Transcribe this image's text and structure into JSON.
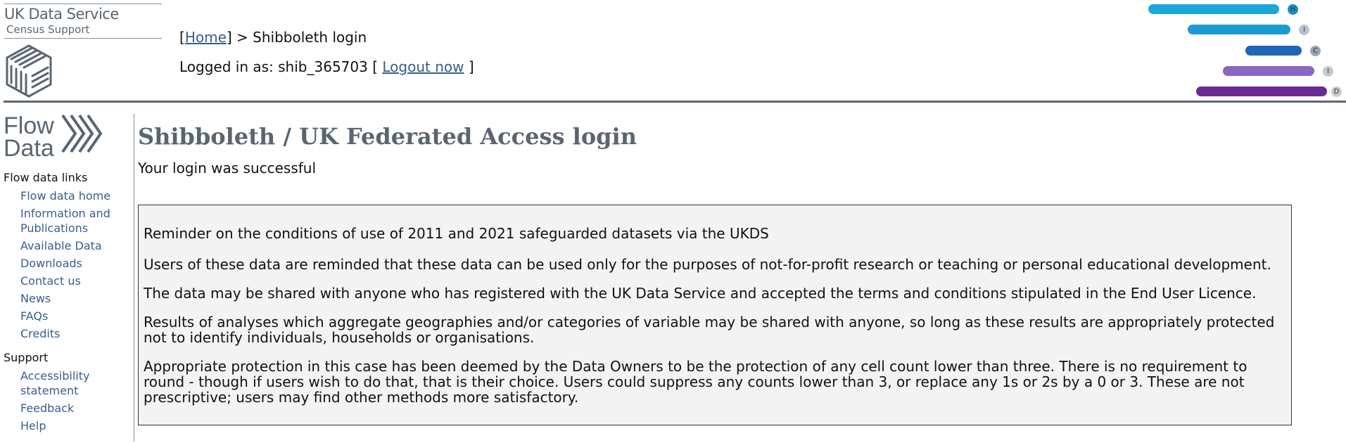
{
  "brand": {
    "title": "UK Data Service",
    "subtitle": "Census Support"
  },
  "breadcrumb": {
    "open": "[",
    "home": "Home",
    "close": "] > ",
    "current": "Shibboleth login"
  },
  "user": {
    "label": "Logged in as:",
    "name": "shib_365703",
    "bracket_open": "[",
    "logout": "Logout now",
    "bracket_close": "]"
  },
  "census_bars": [
    {
      "letter": "H",
      "color": "#1aa8d6"
    },
    {
      "letter": "I",
      "color": "#1e9ad3"
    },
    {
      "letter": "C",
      "color": "#1f67b5"
    },
    {
      "letter": "I",
      "color": "#8a67c0"
    },
    {
      "letter": "D",
      "color": "#6a2b91"
    }
  ],
  "flow_logo": {
    "line1": "Flow",
    "line2": "Data"
  },
  "sidebar": {
    "flow": {
      "heading": "Flow data links",
      "items": [
        "Flow data home",
        "Information and Publications",
        "Available Data",
        "Downloads",
        "Contact us",
        "News",
        "FAQs",
        "Credits"
      ]
    },
    "support": {
      "heading": "Support",
      "items": [
        "Accessibility statement",
        "Feedback",
        "Help"
      ]
    }
  },
  "main": {
    "title": "Shibboleth / UK Federated Access login",
    "status": "Your login was successful"
  },
  "notice": {
    "heading": "Reminder on the conditions of use of 2011 and 2021 safeguarded datasets via the UKDS",
    "paragraphs": [
      "Users of these data are reminded that these data can be used only for the purposes of not-for-profit research or teaching or personal educational development.",
      "The data may be shared with anyone who has registered with the UK Data Service and accepted the terms and conditions stipulated in the End User Licence.",
      "Results of analyses which aggregate geographies and/or categories of variable may be shared with anyone, so long as these results are appropriately protected not to identify individuals, households or organisations.",
      "Appropriate protection in this case has been deemed by the Data Owners to be the protection of any cell count lower than three. There is no requirement to round - though if users wish to do that, that is their choice. Users could suppress any counts lower than 3, or replace any 1s or 2s by a 0 or 3. These are not prescriptive; users may find other methods more satisfactory."
    ]
  }
}
